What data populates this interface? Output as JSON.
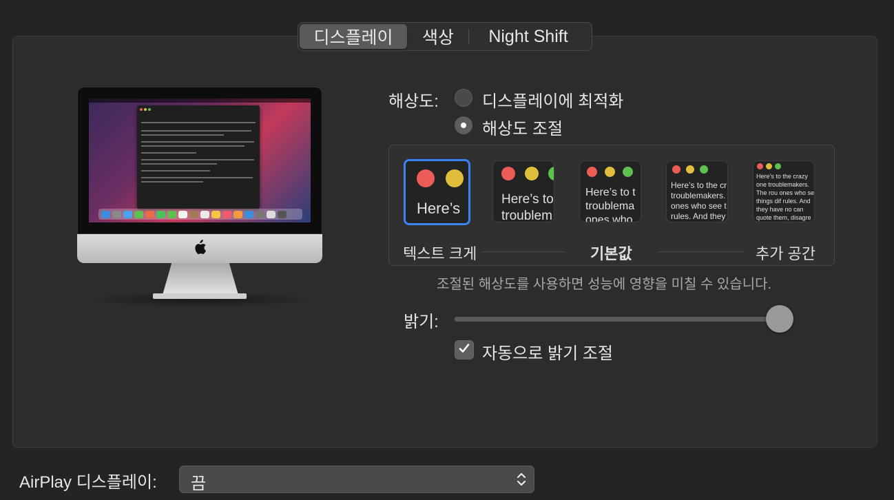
{
  "tabs": [
    {
      "label": "디스플레이",
      "selected": true
    },
    {
      "label": "색상",
      "selected": false
    },
    {
      "label": "Night Shift",
      "selected": false
    }
  ],
  "resolution": {
    "label": "해상도:",
    "options": [
      {
        "label": "디스플레이에 최적화",
        "selected": false
      },
      {
        "label": "해상도 조절",
        "selected": true
      }
    ]
  },
  "scaling": {
    "previews": [
      {
        "text": "Here’s",
        "selected": true
      },
      {
        "text": "Here’s to troublem",
        "selected": false
      },
      {
        "text": "Here’s to t troublema ones who",
        "selected": false
      },
      {
        "text": "Here’s to the cr troublemakers. ones who see t rules. And they",
        "selected": false
      },
      {
        "text": "Here’s to the crazy one troublemakers. The rou ones who see things dif rules. And they have no can quote them, disagre them. About the only th Because they change th",
        "selected": false
      }
    ],
    "left_label": "텍스트 크게",
    "center_label": "기본값",
    "right_label": "추가 공간"
  },
  "performance_note": "조절된 해상도를 사용하면 성능에 영향을 미칠 수 있습니다.",
  "brightness": {
    "label": "밝기:",
    "level": 0.96,
    "auto_checked": true,
    "auto_label": "자동으로 밝기 조절"
  },
  "airplay": {
    "label": "AirPlay 디스플레이:",
    "value": "끔"
  },
  "icons": {
    "apple": "apple-logo-icon",
    "check": "checkmark-icon",
    "popup": "up-down-chevron-icon"
  },
  "colors": {
    "accent": "#3a84f5",
    "red": "#ec5d57",
    "yellow": "#e0bd3a",
    "green": "#5ec04f"
  }
}
